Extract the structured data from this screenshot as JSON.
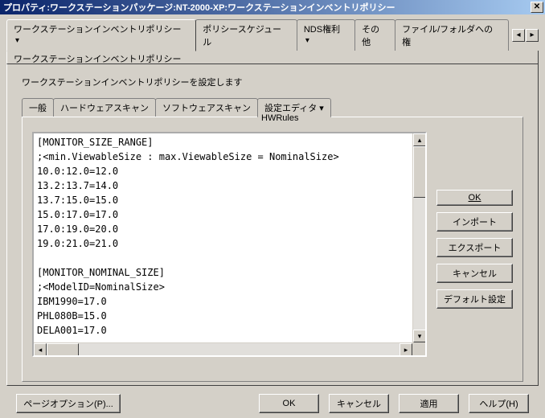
{
  "title": "プロパティ:ワークステーションパッケージ:NT-2000-XP:ワークステーションインベントリポリシー",
  "tabs": {
    "main": [
      "ワークステーションインベントリポリシー",
      "ポリシースケジュール",
      "NDS権利",
      "その他",
      "ファイル/フォルダへの権"
    ],
    "main_subtitle": "ワークステーションインベントリポリシー"
  },
  "description": "ワークステーションインベントリポリシーを設定します",
  "inner_tabs": {
    "items": [
      "一般",
      "ハードウェアスキャン",
      "ソフトウェアスキャン",
      "設定エディタ"
    ],
    "sublabel": "HWRules"
  },
  "editor_text": "[MONITOR_SIZE_RANGE]\n;<min.ViewableSize : max.ViewableSize = NominalSize>\n10.0:12.0=12.0\n13.2:13.7=14.0\n13.7:15.0=15.0\n15.0:17.0=17.0\n17.0:19.0=20.0\n19.0:21.0=21.0\n\n[MONITOR_NOMINAL_SIZE]\n;<ModelID=NominalSize>\nIBM1990=17.0\nPHL080B=15.0\nDELA001=17.0",
  "side_buttons": {
    "ok": "OK",
    "import": "インポート",
    "export": "エクスポート",
    "cancel": "キャンセル",
    "default": "デフォルト設定"
  },
  "bottom_buttons": {
    "page_options": "ページオプション(P)...",
    "ok": "OK",
    "cancel": "キャンセル",
    "apply": "適用",
    "help": "ヘルプ(H)"
  }
}
